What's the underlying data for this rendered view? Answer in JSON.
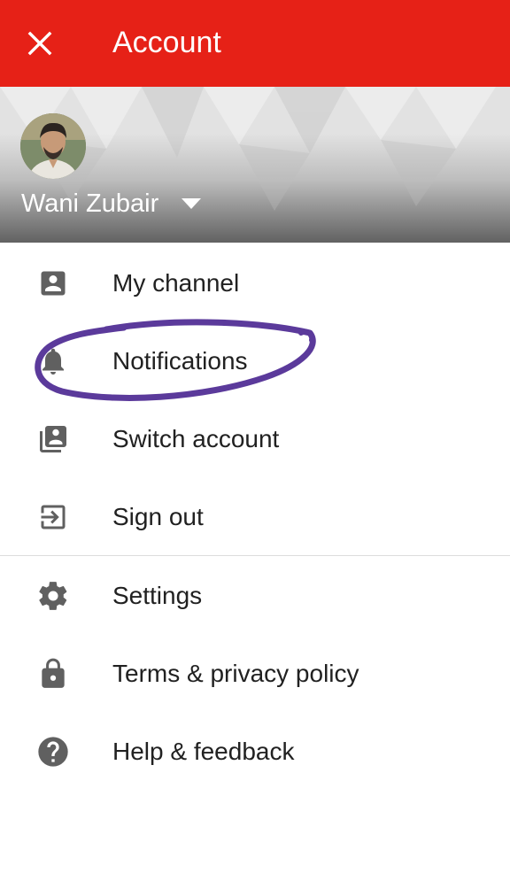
{
  "header": {
    "title": "Account",
    "close_icon": "close-icon",
    "background_color": "#e62117"
  },
  "profile": {
    "name": "Wani Zubair",
    "avatar_icon": "avatar",
    "switch_icon": "caret-down-icon"
  },
  "menu": {
    "group1": [
      {
        "label": "My channel",
        "icon": "account-box-icon"
      },
      {
        "label": "Notifications",
        "icon": "bell-icon"
      },
      {
        "label": "Switch account",
        "icon": "switch-account-icon"
      },
      {
        "label": "Sign out",
        "icon": "exit-icon"
      }
    ],
    "group2": [
      {
        "label": "Settings",
        "icon": "gear-icon"
      },
      {
        "label": "Terms & privacy policy",
        "icon": "lock-icon"
      },
      {
        "label": "Help & feedback",
        "icon": "help-icon"
      }
    ]
  },
  "annotation": {
    "color": "#5b3a9b",
    "target": "Notifications"
  }
}
